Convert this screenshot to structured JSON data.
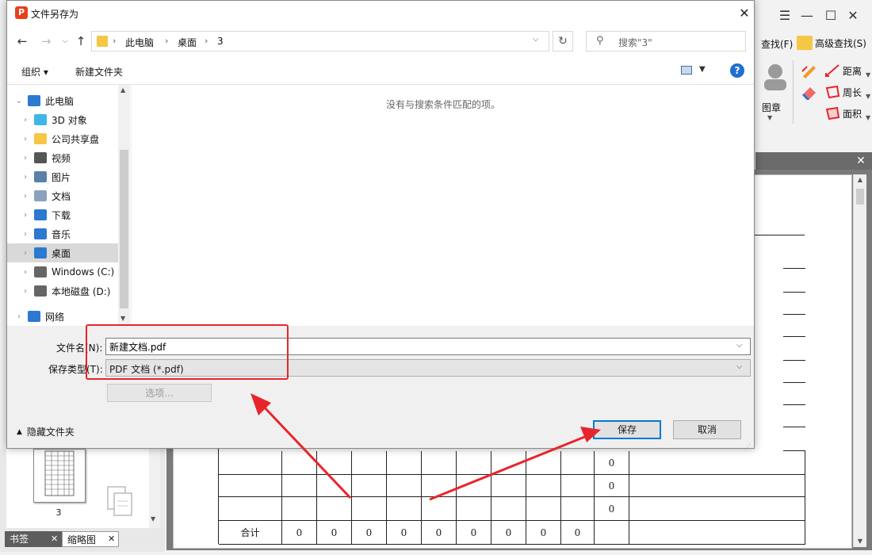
{
  "background_app": {
    "ribbon": {
      "find": "查找(F)",
      "advanced_find": "高级查找(S)",
      "distance": "距离",
      "perimeter": "周长",
      "area": "面积",
      "stamp": "图章"
    },
    "thumbnail_page_number": "3",
    "tabs": {
      "bookmarks": "书签",
      "thumbnails": "缩略图"
    },
    "table": {
      "total_label": "合计",
      "row_values": [
        "0",
        "0",
        "0"
      ],
      "total_values": [
        "0",
        "0",
        "0",
        "0",
        "0",
        "0",
        "0",
        "0",
        "0"
      ]
    }
  },
  "dialog": {
    "title": "文件另存为",
    "breadcrumb": [
      "此电脑",
      "桌面",
      "3"
    ],
    "search_placeholder": "搜索\"3\"",
    "toolbar": {
      "organize": "组织 ▾",
      "new_folder": "新建文件夹"
    },
    "nav_items": [
      {
        "label": "此电脑",
        "icon": "computer-icon"
      },
      {
        "label": "3D 对象",
        "icon": "3d-objects-icon"
      },
      {
        "label": "公司共享盘",
        "icon": "shared-drive-icon"
      },
      {
        "label": "视频",
        "icon": "video-icon"
      },
      {
        "label": "图片",
        "icon": "pictures-icon"
      },
      {
        "label": "文档",
        "icon": "documents-icon"
      },
      {
        "label": "下载",
        "icon": "download-icon"
      },
      {
        "label": "音乐",
        "icon": "music-icon"
      },
      {
        "label": "桌面",
        "icon": "desktop-icon"
      },
      {
        "label": "Windows (C:)",
        "icon": "drive-icon"
      },
      {
        "label": "本地磁盘 (D:)",
        "icon": "drive-icon"
      },
      {
        "label": "网络",
        "icon": "network-icon"
      }
    ],
    "empty_message": "没有与搜索条件匹配的项。",
    "file_name_label": "文件名(N):",
    "file_name_value": "新建文档.pdf",
    "save_type_label": "保存类型(T):",
    "save_type_value": "PDF 文档 (*.pdf)",
    "options_label": "选项...",
    "hide_folders_label": "隐藏文件夹",
    "save_label": "保存",
    "cancel_label": "取消"
  },
  "colors": {
    "annotation_red": "#e8252b",
    "accent_blue": "#0078d7"
  }
}
